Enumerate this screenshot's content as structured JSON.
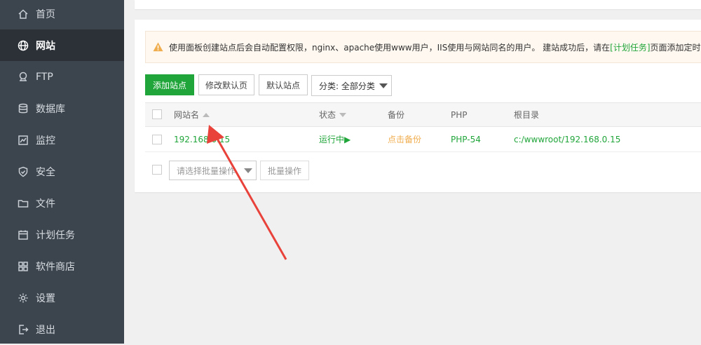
{
  "sidebar": {
    "items": [
      {
        "label": "首页",
        "icon": "home-icon"
      },
      {
        "label": "网站",
        "icon": "globe-icon",
        "active": true
      },
      {
        "label": "FTP",
        "icon": "ftp-server-icon"
      },
      {
        "label": "数据库",
        "icon": "database-icon"
      },
      {
        "label": "监控",
        "icon": "monitor-chart-icon"
      },
      {
        "label": "安全",
        "icon": "shield-icon"
      },
      {
        "label": "文件",
        "icon": "folder-icon"
      },
      {
        "label": "计划任务",
        "icon": "calendar-icon"
      },
      {
        "label": "软件商店",
        "icon": "grid-apps-icon"
      },
      {
        "label": "设置",
        "icon": "gear-icon"
      },
      {
        "label": "退出",
        "icon": "logout-icon"
      }
    ]
  },
  "notice": {
    "text_before": "使用面板创建站点后会自动配置权限，nginx、apache使用www用户，IIS使用与网站同名的用户。 建站成功后，请在",
    "link": "[计划任务]",
    "text_after": "页面添加定时备"
  },
  "toolbar": {
    "add_site": "添加站点",
    "edit_default_page": "修改默认页",
    "default_site": "默认站点",
    "category_select": "分类: 全部分类"
  },
  "table": {
    "headers": {
      "site_name": "网站名",
      "status": "状态",
      "backup": "备份",
      "php": "PHP",
      "root": "根目录"
    },
    "rows": [
      {
        "site_name": "192.168.0.15",
        "status": "运行中▶",
        "backup": "点击备份",
        "php": "PHP-54",
        "root": "c:/wwwroot/192.168.0.15"
      }
    ]
  },
  "bulk": {
    "placeholder": "请选择批量操作",
    "button": "批量操作"
  },
  "colors": {
    "sidebar_bg": "#3c444d",
    "sidebar_active": "#2c3138",
    "accent_green": "#20a53a",
    "backup_orange": "#f0ad4e",
    "annotation_red": "#e8423a"
  }
}
